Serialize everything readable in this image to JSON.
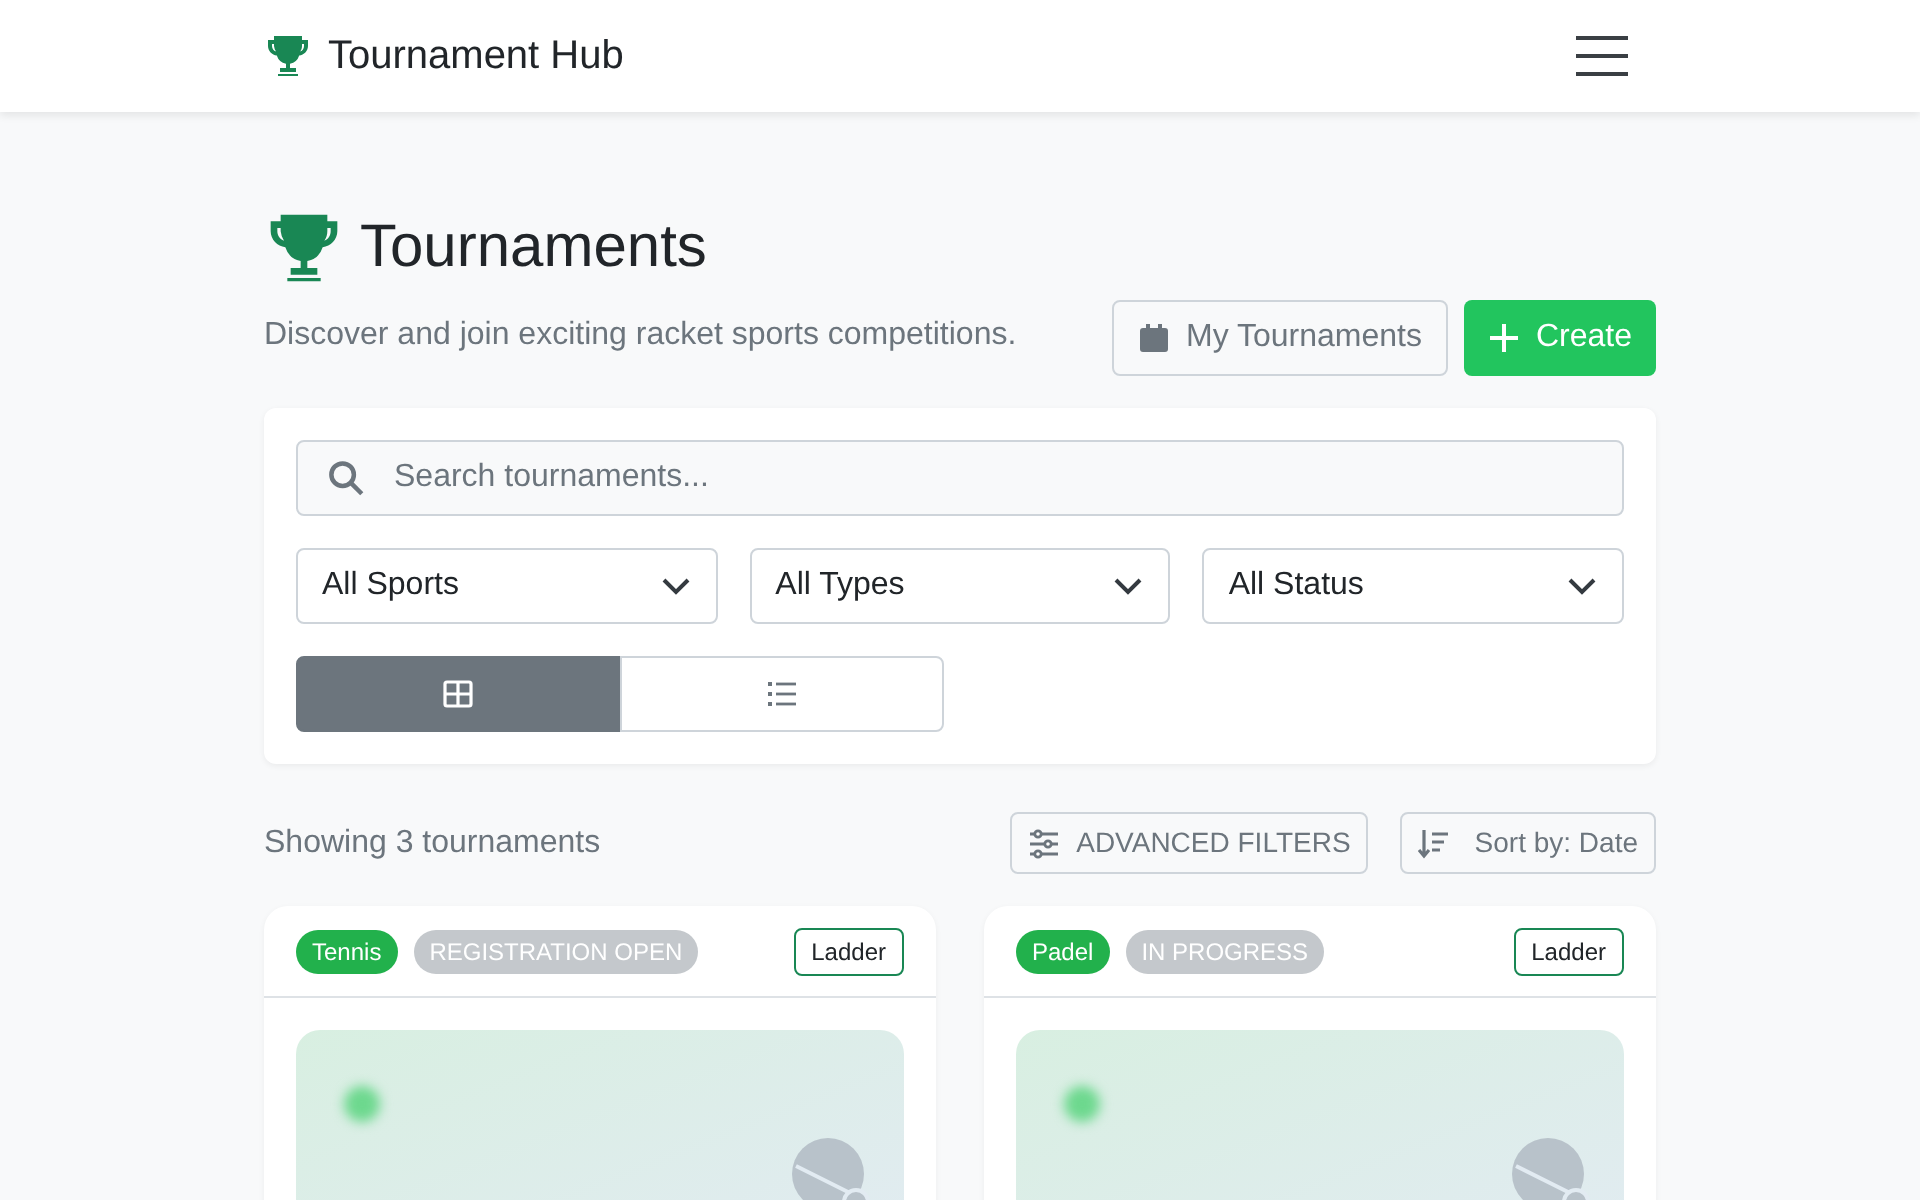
{
  "navbar": {
    "brand": "Tournament Hub"
  },
  "header": {
    "title": "Tournaments",
    "subtitle": "Discover and join exciting racket sports competitions.",
    "buttons": [
      {
        "kind": "outline",
        "label": "My Tournaments"
      },
      {
        "kind": "primary",
        "label": "Create"
      }
    ]
  },
  "search": {
    "placeholder": "Search tournaments..."
  },
  "filters": [
    {
      "value": "All Sports"
    },
    {
      "value": "All Types"
    },
    {
      "value": "All Status"
    }
  ],
  "views": [
    {
      "kind": "grid",
      "selected": true
    },
    {
      "kind": "list",
      "selected": false
    }
  ],
  "results": {
    "count": "Showing 3 tournaments",
    "advanced": "ADVANCED FILTERS",
    "sort_label": "Sort by:",
    "sort_value": "Date"
  },
  "cards": [
    {
      "sport": "Tennis",
      "status": "REGISTRATION OPEN",
      "type": "Ladder"
    },
    {
      "sport": "Padel",
      "status": "IN PROGRESS",
      "type": "Ladder"
    }
  ]
}
